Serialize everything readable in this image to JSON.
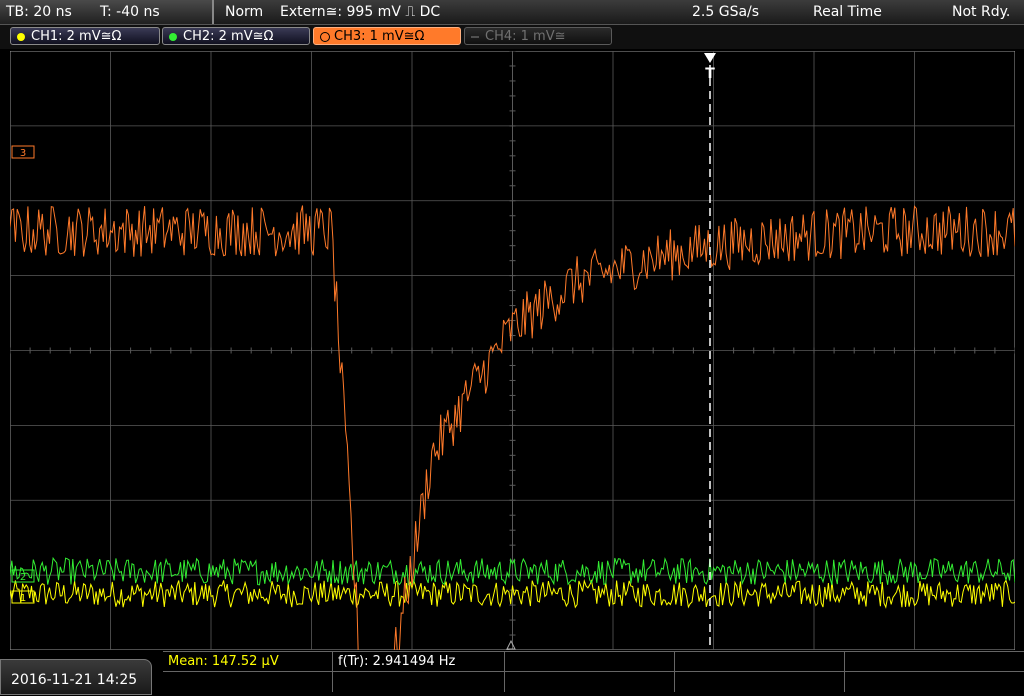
{
  "topbar": {
    "timebase": "TB: 20 ns",
    "trigger_time": "T: -40 ns",
    "trigger_mode": "Norm",
    "trigger_source": "Extern≅: 995 mV ⎍ DC",
    "sample_rate": "2.5 GSa/s",
    "acq_mode": "Real Time",
    "status": "Not Rdy."
  },
  "channels": [
    {
      "label": "CH1: 2 mV≅Ω",
      "color": "#ffff00"
    },
    {
      "label": "CH2: 2 mV≅Ω",
      "color": "#33ee33"
    },
    {
      "label": "CH3: 1 mV≅Ω",
      "color": "#ff7a2a"
    },
    {
      "label": "CH4: 1 mV≅",
      "color": "#707070"
    }
  ],
  "markers": {
    "ch3": "3",
    "ch2": "2",
    "ch1": "1",
    "trigger": "T"
  },
  "measurements": {
    "mean": "Mean: 147.52 µV",
    "freq": "f(Tr): 2.941494 Hz"
  },
  "datetime": "2016-11-21 14:25",
  "colors": {
    "ch1": "#ffff00",
    "ch2": "#33ee33",
    "ch3": "#ff7a2a",
    "grid": "#5a5a5a"
  },
  "chart_data": {
    "type": "line",
    "grid": {
      "divisions_x": 10,
      "divisions_y": 8
    },
    "series": [
      {
        "name": "CH3",
        "color": "#ff7a2a",
        "x": [
          0,
          0.3,
          0.6,
          0.9,
          1.2,
          1.5,
          1.8,
          2.0,
          2.4,
          2.8,
          3.2,
          3.5,
          3.8,
          4.2,
          4.6,
          5.0,
          5.6,
          6.3,
          7.0,
          8.0,
          9.0,
          10.0
        ],
        "y": [
          1.6,
          1.6,
          1.6,
          1.6,
          1.6,
          1.6,
          1.6,
          1.6,
          1.6,
          1.6,
          1.6,
          -4.5,
          -4.3,
          -1.4,
          -0.5,
          0.3,
          0.9,
          1.2,
          1.4,
          1.55,
          1.6,
          1.6
        ]
      },
      {
        "name": "CH2",
        "color": "#33ee33",
        "x": [
          0,
          10
        ],
        "y": [
          -2.95,
          -2.95
        ]
      },
      {
        "name": "CH1",
        "color": "#ffff00",
        "x": [
          0,
          10
        ],
        "y": [
          -3.25,
          -3.25
        ]
      }
    ]
  }
}
